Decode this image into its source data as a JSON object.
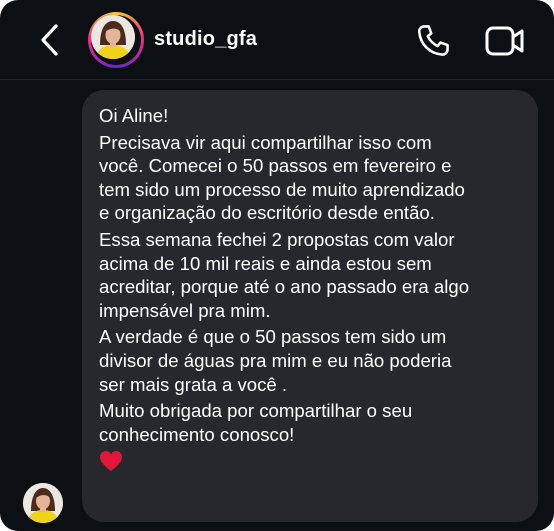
{
  "header": {
    "username": "studio_gfa",
    "back_icon": "chevron-left-icon",
    "call_icon": "phone-icon",
    "video_icon": "video-camera-icon"
  },
  "message": {
    "paragraphs": [
      "Oi Aline!",
      "Precisava vir aqui compartilhar isso com\nvocê. Comecei o 50 passos em fevereiro e\ntem sido um processo de muito aprendizado\ne organização do escritório desde então.",
      "Essa semana fechei 2 propostas com valor\nacima de 10 mil reais e ainda estou sem\nacreditar, porque até o ano passado era algo\nimpensável pra mim.",
      "A verdade é que o 50 passos tem sido um\ndivisor de águas pra mim e eu não poderia\nser mais grata a você .",
      "Muito obrigada por compartilhar o seu\nconhecimento conosco!"
    ],
    "emoji": "red-heart-icon"
  },
  "colors": {
    "background": "#0c0f14",
    "bubble": "#26282d",
    "text": "#ffffff",
    "heart": "#e0173a"
  }
}
